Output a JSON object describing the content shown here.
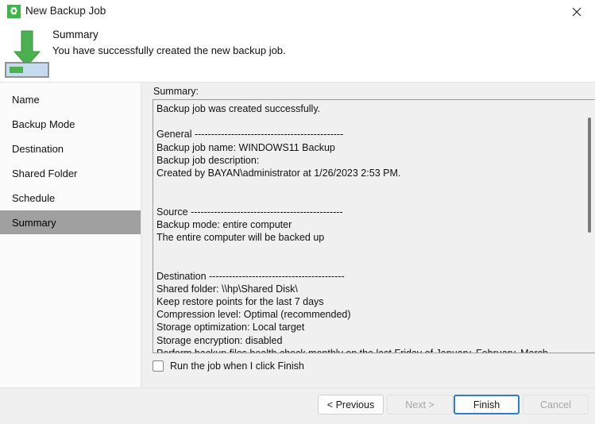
{
  "window": {
    "title": "New Backup Job",
    "icon": "gear-icon",
    "close_label": "✕"
  },
  "header": {
    "title": "Summary",
    "subtitle": "You have successfully created the new backup job.",
    "graphic": "download-arrow-icon"
  },
  "sidebar": {
    "items": [
      {
        "label": "Name",
        "selected": false
      },
      {
        "label": "Backup Mode",
        "selected": false
      },
      {
        "label": "Destination",
        "selected": false
      },
      {
        "label": "Shared Folder",
        "selected": false
      },
      {
        "label": "Schedule",
        "selected": false
      },
      {
        "label": "Summary",
        "selected": true
      }
    ]
  },
  "main": {
    "summary_label": "Summary:",
    "summary_text": "Backup job was created successfully.\n\nGeneral ---------------------------------------------\nBackup job name: WINDOWS11 Backup\nBackup job description:\nCreated by BAYAN\\administrator at 1/26/2023 2:53 PM.\n\n\nSource ----------------------------------------------\nBackup mode: entire computer\nThe entire computer will be backed up\n\n\nDestination -----------------------------------------\nShared folder: \\\\hp\\Shared Disk\\\nKeep restore points for the last 7 days\nCompression level: Optimal (recommended)\nStorage optimization: Local target\nStorage encryption: disabled\nPerform backup files health check monthly on the last Friday of January, February, March, April, May, June, July, August, September, October, November, December.",
    "checkbox": {
      "label": "Run the job when I click Finish",
      "checked": false
    }
  },
  "footer": {
    "buttons": [
      {
        "id": "previous",
        "label": "< Previous",
        "state": "enabled"
      },
      {
        "id": "next",
        "label": "Next >",
        "state": "disabled"
      },
      {
        "id": "finish",
        "label": "Finish",
        "state": "default"
      },
      {
        "id": "cancel",
        "label": "Cancel",
        "state": "disabled"
      }
    ]
  },
  "colors": {
    "accent_green": "#3cb54a",
    "focus_blue": "#2d7dd2",
    "selection_gray": "#a0a0a0",
    "panel_gray": "#f0f0f0"
  }
}
